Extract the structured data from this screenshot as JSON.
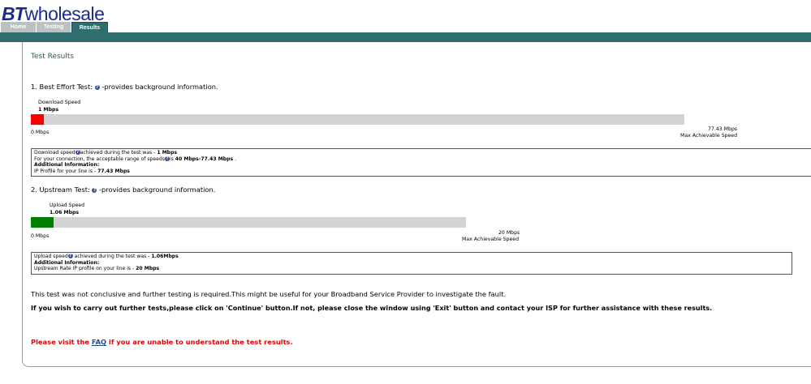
{
  "brand": {
    "bt": "BT",
    "rest": "wholesale"
  },
  "tabs": [
    {
      "label": "Home"
    },
    {
      "label": "Testing"
    },
    {
      "label": "Results"
    }
  ],
  "page_title": "Test Results",
  "download": {
    "heading": "1. Best Effort Test:",
    "help_text": "-provides background information.",
    "bar_label": "Download Speed",
    "value_label": "1 Mbps",
    "min_label": "0 Mbps",
    "max_value_label": "77.43 Mbps",
    "max_caption": "Max Achievable Speed",
    "value": 1,
    "max": 77.43,
    "fill_color": "#ff0000",
    "info": {
      "line1_a": "Download speed",
      "line1_b": "achieved during the test was - ",
      "line1_val": "1 Mbps",
      "line2_a": "For your connection, the acceptable range of speeds",
      "line2_b": "is ",
      "line2_val": "40 Mbps-77.43 Mbps",
      "line2_end": " .",
      "line3": "Additional Information:",
      "line4_a": "IP Profile for your line is - ",
      "line4_val": "77.43 Mbps"
    }
  },
  "upload": {
    "heading": "2. Upstream Test:",
    "help_text": "-provides background information.",
    "bar_label": "Upload Speed",
    "value_label": "1.06 Mbps",
    "min_label": "0 Mbps",
    "max_value_label": "20 Mbps",
    "max_caption": "Max Achievable Speed",
    "value": 1.06,
    "max": 20,
    "fill_color": "#008000",
    "info": {
      "line1_a": "Upload speed",
      "line1_b": " achieved during the test was - ",
      "line1_val": "1.06Mbps",
      "line2": "Additional Information:",
      "line3_a": "Upstream Rate IP profile on your line is - ",
      "line3_val": "20 Mbps"
    }
  },
  "note": "This test was not conclusive and further testing is required.This might be useful for your Broadband Service Provider to investigate the fault.",
  "instruction": "If you wish to carry out further tests,please click on 'Continue' button.If not, please close the window using 'Exit' button and contact your ISP for further assistance with these results.",
  "faq_line": {
    "before": "Please visit the ",
    "link": "FAQ",
    "after": " if you are unable to understand the test results."
  },
  "icons": {
    "help": "help-icon"
  },
  "colors": {
    "header_bar": "#2f6e6e",
    "brand": "#1a2b8c",
    "title": "#275f5f",
    "warning": "#ee0000"
  }
}
